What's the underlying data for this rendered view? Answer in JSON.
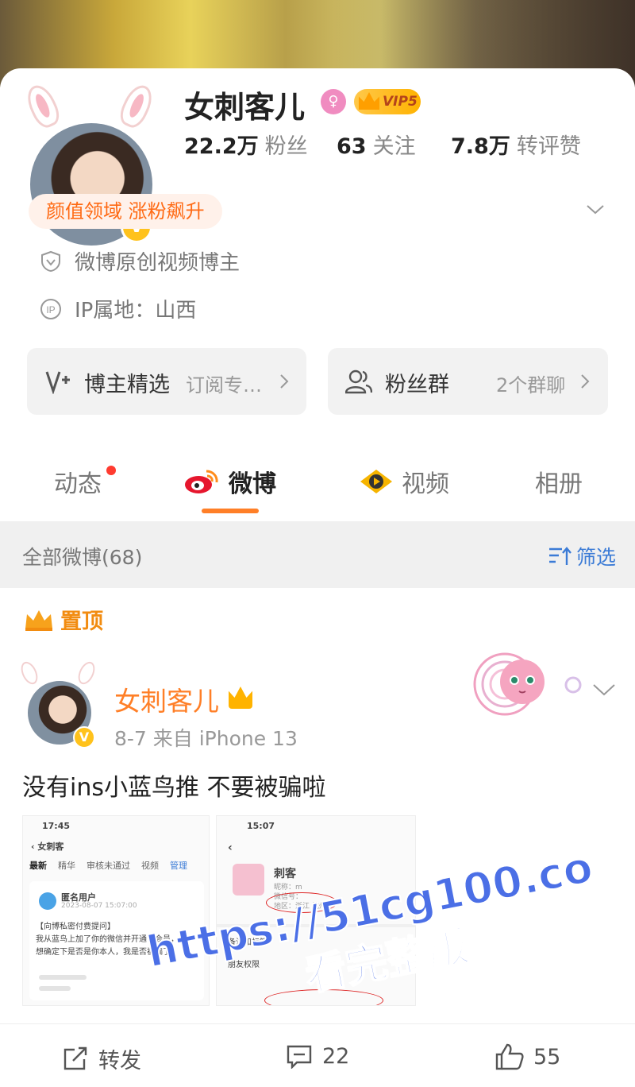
{
  "profile": {
    "name": "女刺客儿",
    "vip_label": "VIP5",
    "verified_mark": "V",
    "stats": [
      {
        "num": "22.2万",
        "label": "粉丝"
      },
      {
        "num": "63",
        "label": "关注"
      },
      {
        "num": "7.8万",
        "label": "转评赞"
      }
    ],
    "tag": "颜值领域 涨粉飙升",
    "info": [
      {
        "icon": "shield-icon",
        "text": "微博原创视频博主"
      },
      {
        "icon": "ip-icon",
        "text": "IP属地：山西"
      }
    ],
    "actions": [
      {
        "icon": "v-plus-icon",
        "title": "博主精选",
        "sub": "订阅专…"
      },
      {
        "icon": "fans-group-icon",
        "title": "粉丝群",
        "sub": "2个群聊"
      }
    ]
  },
  "tabs": [
    {
      "label": "动态",
      "dot": true
    },
    {
      "label": "微博",
      "active": true,
      "icon": "weibo-logo-icon"
    },
    {
      "label": "视频",
      "icon": "video-play-icon"
    },
    {
      "label": "相册"
    }
  ],
  "filter": {
    "count_label": "全部微博(68)",
    "filter_label": "筛选"
  },
  "post": {
    "pinned_label": "置顶",
    "author": "女刺客儿",
    "meta": "8-7  来自 iPhone 13",
    "text": "没有ins小蓝鸟推 不要被骗啦",
    "shot1": {
      "time": "17:45",
      "back_title": "女刺客",
      "tabs": [
        "最新",
        "精华",
        "审核未通过",
        "视频",
        "管理"
      ],
      "user": "匿名用户",
      "date": "2023-08-07 15:07:00",
      "body1": "【向博私密付费提问】",
      "body2": "我从蓝鸟上加了你的微信并开通了会员，我",
      "body3": "想确定下是否是你本人，我是否被骗了"
    },
    "shot2": {
      "time": "15:07",
      "nick": "刺客",
      "line1": "昵称：m",
      "line2": "微信号：",
      "line3": "地区：浙江 杭州",
      "menu1": "备注和标签",
      "menu2": "朋友权限"
    },
    "actions": {
      "repost": "转发",
      "comments": "22",
      "likes": "55"
    }
  },
  "watermark": {
    "line1": "https://51cg100.co",
    "line2": "看完整版"
  },
  "colors": {
    "accent": "#ff7f27",
    "link": "#3b7bd6",
    "badge": "#ffc21c"
  }
}
